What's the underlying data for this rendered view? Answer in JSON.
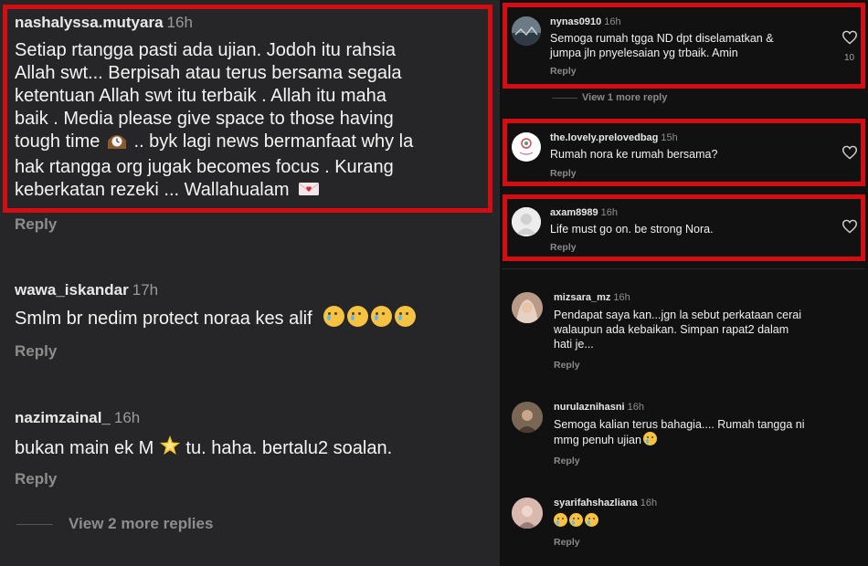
{
  "left": {
    "comments": [
      {
        "username": "nashalyssa.mutyara",
        "time": "16h",
        "lines": [
          "Setiap rtangga pasti ada ujian. Jodoh itu rahsia",
          "Allah swt... Berpisah atau terus bersama segala",
          "ketentuan Allah swt itu terbaik . Allah itu maha",
          "baik . Media please give space to those having",
          "tough time",
          ".. byk lagi news bermanfaat why la",
          "hak rtangga org jugak becomes focus . Kurang",
          "keberkatan rezeki ... Wallahualam"
        ],
        "reply": "Reply"
      },
      {
        "username": "wawa_iskandar",
        "time": "17h",
        "text": "Smlm br nedim protect noraa kes alif",
        "reply": "Reply"
      },
      {
        "username": "nazimzainal_",
        "time": "16h",
        "text_before": "bukan main ek M",
        "text_after": "tu. haha. bertalu2 soalan.",
        "reply": "Reply"
      }
    ],
    "view_more": "View 2 more replies"
  },
  "right": {
    "comments": [
      {
        "username": "nynas0910",
        "time": "16h",
        "lines": [
          "Semoga rumah tgga ND dpt diselamatkan &",
          "jumpa jln pnyelesaian yg trbaik. Amin"
        ],
        "reply": "Reply",
        "likes": "10"
      },
      {
        "username": "the.lovely.prelovedbag",
        "time": "15h",
        "lines": [
          "Rumah nora ke rumah bersama?"
        ],
        "reply": "Reply"
      },
      {
        "username": "axam8989",
        "time": "16h",
        "lines": [
          "Life must go on. be strong Nora."
        ],
        "reply": "Reply"
      },
      {
        "username": "mizsara_mz",
        "time": "16h",
        "lines": [
          "Pendapat saya kan...jgn la sebut perkataan cerai",
          "walaupun ada kebaikan. Simpan rapat2 dalam",
          "hati je..."
        ],
        "reply": "Reply"
      },
      {
        "username": "nurulaznihasni",
        "time": "16h",
        "lines": [
          "Semoga kalian terus bahagia.... Rumah tangga ni",
          "mmg penuh ujian"
        ],
        "reply": "Reply"
      },
      {
        "username": "syarifahshazliana",
        "time": "16h",
        "reply": "Reply"
      }
    ],
    "view_more": "View 1 more reply"
  },
  "colors": {
    "highlight_border": "#d40d12",
    "left_background": "#262629",
    "right_background": "#111112"
  }
}
